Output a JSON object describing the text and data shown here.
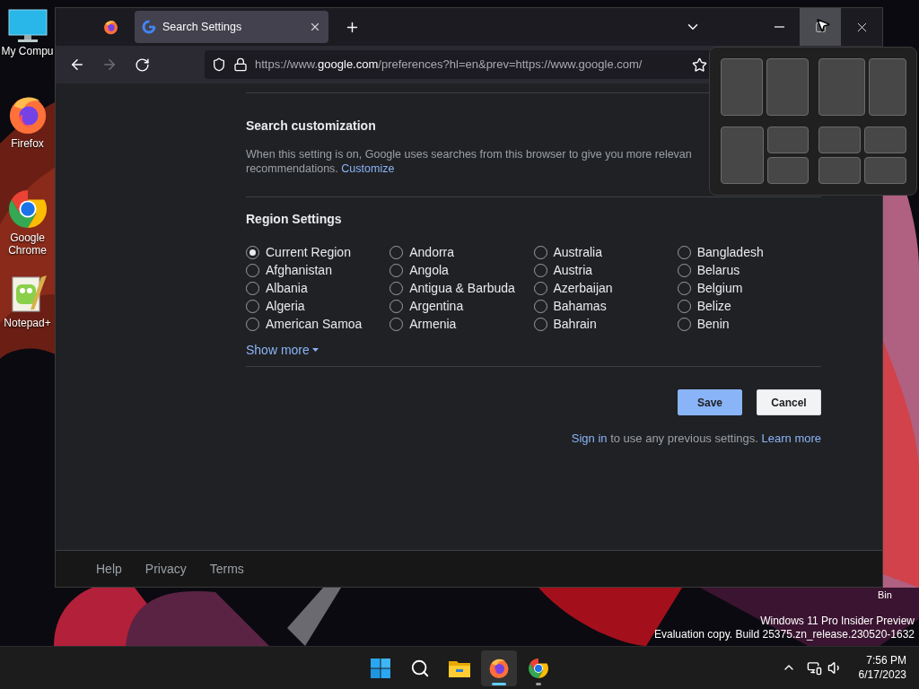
{
  "desktop_icons": [
    {
      "label": "My Compu",
      "kind": "computer"
    },
    {
      "label": "Firefox",
      "kind": "firefox"
    },
    {
      "label": "Google Chrome",
      "kind": "chrome"
    },
    {
      "label": "Notepad+",
      "kind": "notepad"
    }
  ],
  "recycle_bin": {
    "label": "Bin"
  },
  "browser": {
    "tabs": [
      {
        "kind": "pinned",
        "selected": false
      },
      {
        "kind": "page",
        "title": "Search Settings",
        "selected": true
      }
    ],
    "window_buttons": [
      {
        "kind": "minimize",
        "hovered": false
      },
      {
        "kind": "maximize",
        "hovered": true
      },
      {
        "kind": "close",
        "hovered": false
      }
    ],
    "nav_buttons": [
      {
        "kind": "back",
        "disabled": false
      },
      {
        "kind": "forward",
        "disabled": true
      },
      {
        "kind": "reload",
        "disabled": false
      }
    ],
    "url_parts": [
      "https://www.",
      "google.com",
      "/preferences?hl=en&prev=https://www.google.com/"
    ],
    "page": {
      "search_customization": {
        "heading": "Search customization",
        "line_1": "When this setting is on, Google uses searches from this browser to give you more relevan",
        "line_2": "recommendations.",
        "link": "Customize"
      },
      "region": {
        "heading": "Region Settings",
        "options": [
          {
            "label": "Current Region",
            "selected": true
          },
          {
            "label": "Afghanistan",
            "selected": false
          },
          {
            "label": "Albania",
            "selected": false
          },
          {
            "label": "Algeria",
            "selected": false
          },
          {
            "label": "American Samoa",
            "selected": false
          },
          {
            "label": "Andorra",
            "selected": false
          },
          {
            "label": "Angola",
            "selected": false
          },
          {
            "label": "Antigua & Barbuda",
            "selected": false
          },
          {
            "label": "Argentina",
            "selected": false
          },
          {
            "label": "Armenia",
            "selected": false
          },
          {
            "label": "Australia",
            "selected": false
          },
          {
            "label": "Austria",
            "selected": false
          },
          {
            "label": "Azerbaijan",
            "selected": false
          },
          {
            "label": "Bahamas",
            "selected": false
          },
          {
            "label": "Bahrain",
            "selected": false
          },
          {
            "label": "Bangladesh",
            "selected": false
          },
          {
            "label": "Belarus",
            "selected": false
          },
          {
            "label": "Belgium",
            "selected": false
          },
          {
            "label": "Belize",
            "selected": false
          },
          {
            "label": "Benin",
            "selected": false
          }
        ],
        "show_more": "Show more"
      },
      "buttons": [
        {
          "label": "Save",
          "kind": "primary"
        },
        {
          "label": "Cancel",
          "kind": "secondary"
        }
      ],
      "sign_in": {
        "link": "Sign in",
        "text": "to use any previous settings.",
        "link_2": "Learn more"
      }
    },
    "footer_links": [
      "Help",
      "Privacy",
      "Terms"
    ]
  },
  "snap_layouts": [
    {
      "kind": "halves"
    },
    {
      "kind": "wide-narrow"
    },
    {
      "kind": "left-stack"
    },
    {
      "kind": "quad"
    }
  ],
  "watermark_lines": [
    "Windows 11 Pro Insider Preview",
    "Evaluation copy. Build 25375.zn_release.230520-1632"
  ],
  "taskbar": {
    "apps": [
      {
        "kind": "start",
        "running": false,
        "active": false
      },
      {
        "kind": "search",
        "running": false,
        "active": false
      },
      {
        "kind": "explorer",
        "running": false,
        "active": false
      },
      {
        "kind": "firefox",
        "running": true,
        "active": true
      },
      {
        "kind": "chrome",
        "running": true,
        "active": false
      }
    ],
    "time": "7:56 PM",
    "date": "6/17/2023"
  }
}
